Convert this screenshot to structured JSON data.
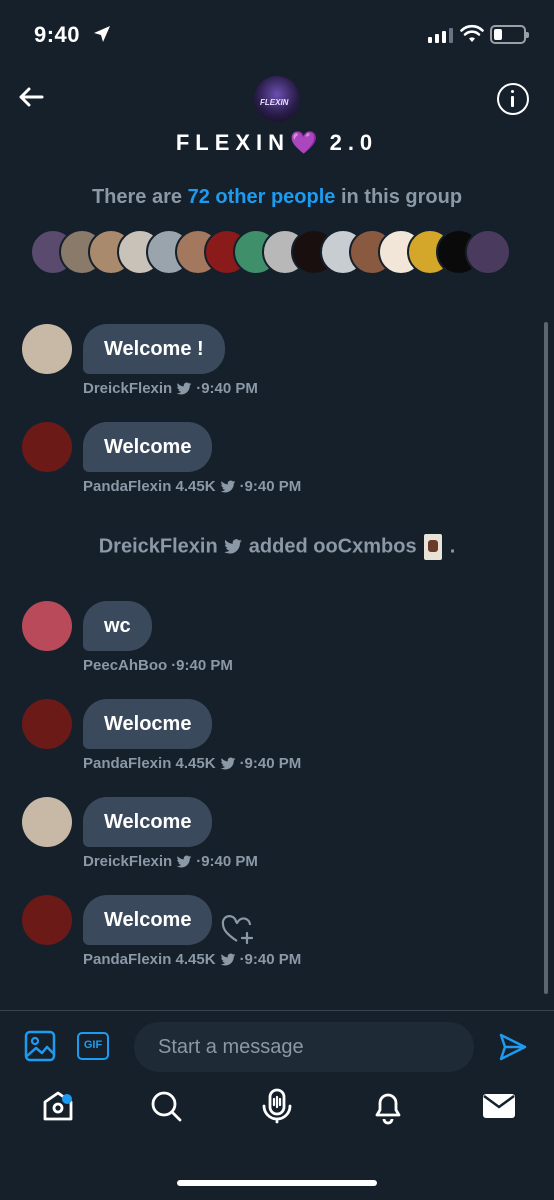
{
  "status_bar": {
    "time": "9:40"
  },
  "header": {
    "group_title": "FLEXIN",
    "group_title_suffix": "2.0",
    "group_title_emoji": "💜",
    "avatar_text": "FLEXIN",
    "members_prefix": "There are",
    "members_link": "72 other people",
    "members_suffix": "in this group",
    "member_avatar_colors": [
      "#5a4b6e",
      "#8a7a6a",
      "#a98a6c",
      "#c9c2b8",
      "#9aa4ad",
      "#a4775f",
      "#8b1a1a",
      "#3f8f6a",
      "#b8b8b8",
      "#1a0f0f",
      "#c8cdd2",
      "#8a5a40",
      "#f1e6d8",
      "#d4a62a",
      "#0a0a0a",
      "#4a3a5e"
    ]
  },
  "messages": [
    {
      "avatar_color": "#c8b9a6",
      "text": "Welcome !",
      "author": "DreickFlexin",
      "verified": true,
      "count": "",
      "time": "·9:40 PM"
    },
    {
      "avatar_color": "#6b1a18",
      "text": "Welcome",
      "author": "PandaFlexin 4.45K",
      "verified": true,
      "count": "",
      "time": "·9:40 PM"
    },
    {
      "avatar_color": "#b84a5a",
      "text": "wc",
      "author": "PeecAhBoo",
      "verified": false,
      "count": "",
      "time": "·9:40 PM"
    },
    {
      "avatar_color": "#6b1a18",
      "text": "Welocme",
      "author": "PandaFlexin 4.45K",
      "verified": true,
      "count": "",
      "time": "·9:40 PM"
    },
    {
      "avatar_color": "#c8b9a6",
      "text": "Welcome",
      "author": "DreickFlexin",
      "verified": true,
      "count": "",
      "time": "·9:40 PM"
    },
    {
      "avatar_color": "#6b1a18",
      "text": "Welcome",
      "author": "PandaFlexin 4.45K",
      "verified": true,
      "count": "",
      "time": "·9:40 PM"
    }
  ],
  "system_message": {
    "actor": "DreickFlexin",
    "action": "added ooCxmbos",
    "end": "."
  },
  "composer": {
    "placeholder": "Start a message",
    "gif_label": "GIF"
  },
  "icons": {
    "back": "arrow-left-icon",
    "info": "info-icon",
    "media": "image-icon",
    "send": "send-icon",
    "like": "heart-plus-icon",
    "tabs": [
      "home-icon",
      "search-icon",
      "spaces-icon",
      "notifications-icon",
      "messages-icon"
    ]
  },
  "colors": {
    "background": "#15202b",
    "accent": "#1d9bf0",
    "bubble": "#3a4a5c",
    "muted": "#8b98a5"
  }
}
